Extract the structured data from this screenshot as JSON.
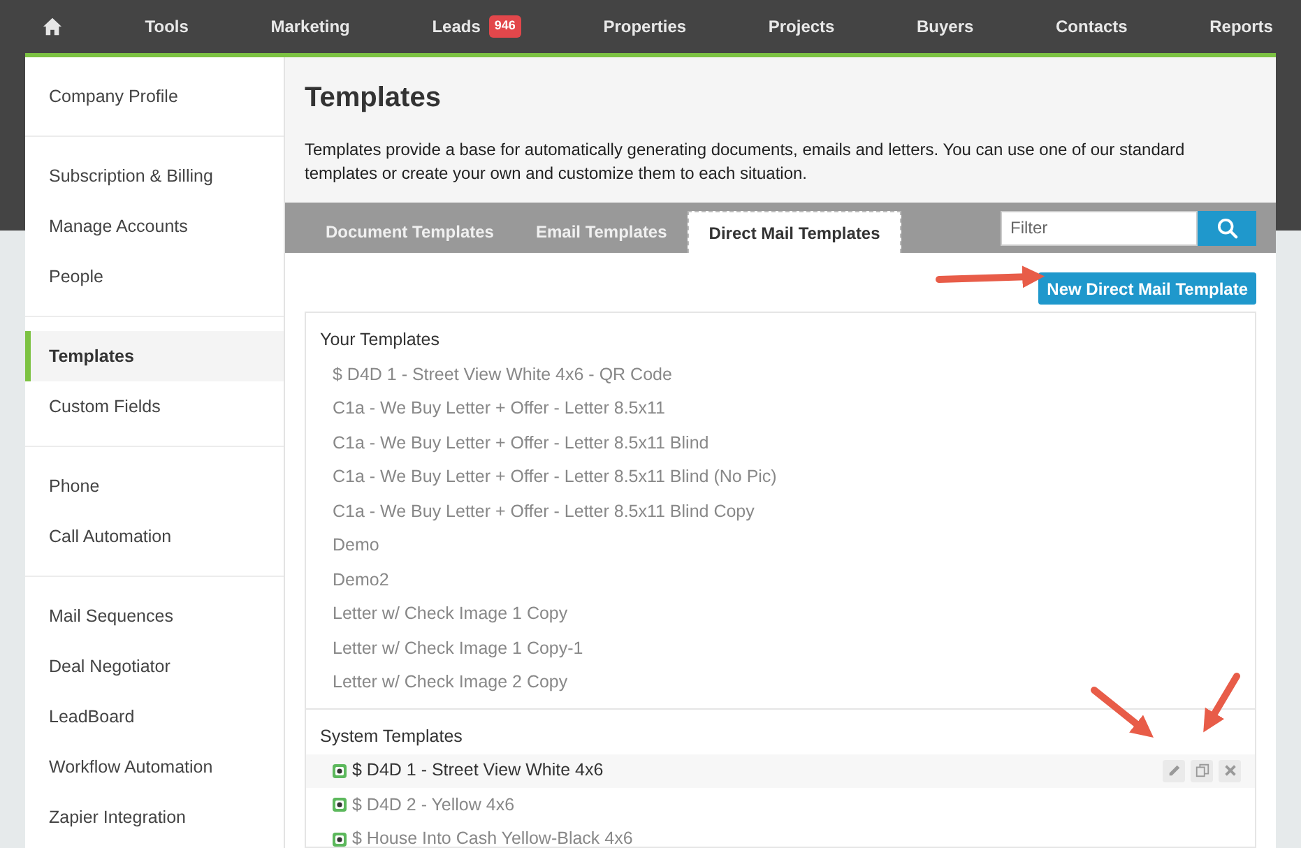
{
  "nav": {
    "items": [
      {
        "kind": "home"
      },
      {
        "kind": "link",
        "label": "Tools"
      },
      {
        "kind": "link",
        "label": "Marketing"
      },
      {
        "kind": "link",
        "label": "Leads",
        "badge": "946"
      },
      {
        "kind": "link",
        "label": "Properties"
      },
      {
        "kind": "link",
        "label": "Projects"
      },
      {
        "kind": "link",
        "label": "Buyers"
      },
      {
        "kind": "link",
        "label": "Contacts"
      },
      {
        "kind": "link",
        "label": "Reports"
      }
    ]
  },
  "sidebar": {
    "groups": [
      {
        "items": [
          {
            "label": "Company Profile",
            "selected": false
          }
        ]
      },
      {
        "items": [
          {
            "label": "Subscription & Billing",
            "selected": false
          },
          {
            "label": "Manage Accounts",
            "selected": false
          },
          {
            "label": "People",
            "selected": false
          }
        ]
      },
      {
        "items": [
          {
            "label": "Templates",
            "selected": true
          },
          {
            "label": "Custom Fields",
            "selected": false
          }
        ]
      },
      {
        "items": [
          {
            "label": "Phone",
            "selected": false
          },
          {
            "label": "Call Automation",
            "selected": false
          }
        ]
      },
      {
        "items": [
          {
            "label": "Mail Sequences",
            "selected": false
          },
          {
            "label": "Deal Negotiator",
            "selected": false
          },
          {
            "label": "LeadBoard",
            "selected": false
          },
          {
            "label": "Workflow Automation",
            "selected": false
          },
          {
            "label": "Zapier Integration",
            "selected": false
          }
        ]
      }
    ]
  },
  "page": {
    "title": "Templates",
    "description": "Templates provide a base for automatically generating documents, emails and letters. You can use one of our standard templates or create your own and customize them to each situation."
  },
  "tabs": [
    {
      "label": "Document Templates",
      "selected": false
    },
    {
      "label": "Email Templates",
      "selected": false
    },
    {
      "label": "Direct Mail Templates",
      "selected": true
    }
  ],
  "filter": {
    "placeholder": "Filter"
  },
  "new_button": "New Direct Mail Template",
  "sections": [
    {
      "title": "Your Templates",
      "kind": "user",
      "templates": [
        {
          "name": "$ D4D 1 - Street View White 4x6 - QR Code",
          "hovered": false
        },
        {
          "name": "C1a - We Buy Letter + Offer - Letter 8.5x11",
          "hovered": false
        },
        {
          "name": "C1a - We Buy Letter + Offer - Letter 8.5x11 Blind",
          "hovered": false
        },
        {
          "name": "C1a - We Buy Letter + Offer - Letter 8.5x11 Blind (No Pic)",
          "hovered": false
        },
        {
          "name": "C1a - We Buy Letter + Offer - Letter 8.5x11 Blind Copy",
          "hovered": false
        },
        {
          "name": "Demo",
          "hovered": false
        },
        {
          "name": "Demo2",
          "hovered": false
        },
        {
          "name": "Letter w/ Check Image 1 Copy",
          "hovered": false
        },
        {
          "name": "Letter w/ Check Image 1 Copy-1",
          "hovered": false
        },
        {
          "name": "Letter w/ Check Image 2 Copy",
          "hovered": false
        }
      ]
    },
    {
      "title": "System Templates",
      "kind": "system",
      "templates": [
        {
          "name": "$ D4D 1 - Street View White 4x6",
          "hovered": true
        },
        {
          "name": "$ D4D 2 - Yellow 4x6",
          "hovered": false
        },
        {
          "name": "$ House Into Cash Yellow-Black 4x6",
          "hovered": false
        }
      ]
    }
  ]
}
